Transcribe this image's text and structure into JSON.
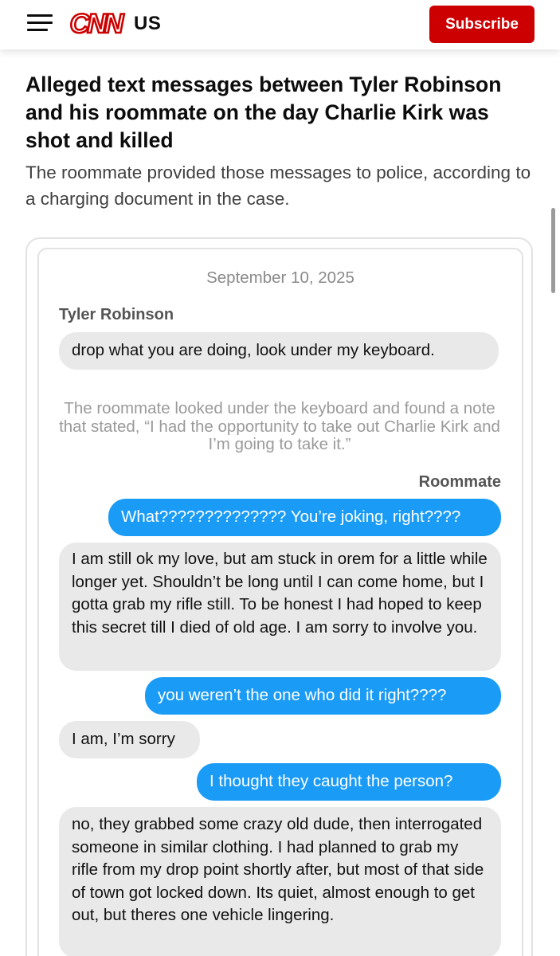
{
  "header": {
    "menu_icon": "hamburger-menu-icon",
    "logo_text": "CNN",
    "edition": "US",
    "subscribe_label": "Subscribe",
    "brand_color": "#cc0000"
  },
  "article": {
    "headline": "Alleged text messages between Tyler Robinson and his roommate on the day Charlie Kirk was shot and killed",
    "subheadline": "The roommate provided those messages to police, according to a charging document in the case."
  },
  "conversation": {
    "date": "September 10, 2025",
    "sender_left": "Tyler Robinson",
    "sender_right": "Roommate",
    "note": "The roommate looked under the keyboard and found a note that stated, “I had the opportunity to take out Charlie Kirk and I’m going to take it.”",
    "messages": [
      {
        "side": "left",
        "text": "drop what you are doing, look under my keyboard."
      },
      {
        "side": "right",
        "text": "What?????????????? You’re joking, right????"
      },
      {
        "side": "left",
        "text": "I am still ok my love, but am stuck in orem for a little while longer yet. Shouldn’t be long until I can come home, but I gotta grab my rifle still. To be honest I had hoped to keep this secret till I died of old age. I am sorry to involve you."
      },
      {
        "side": "right",
        "text": "you weren’t the one who did it right????"
      },
      {
        "side": "left",
        "text": "I am, I’m sorry"
      },
      {
        "side": "right",
        "text": "I thought they caught the person?"
      },
      {
        "side": "left",
        "text": "no, they grabbed some crazy old dude, then interrogated someone in similar clothing. I had planned to grab my rifle from my drop point shortly after, but most of that side of town got locked down. Its quiet, almost enough to get out, but theres one vehicle lingering."
      }
    ],
    "colors": {
      "left_bubble": "#e9e9e9",
      "right_bubble": "#1a9bf5"
    }
  }
}
